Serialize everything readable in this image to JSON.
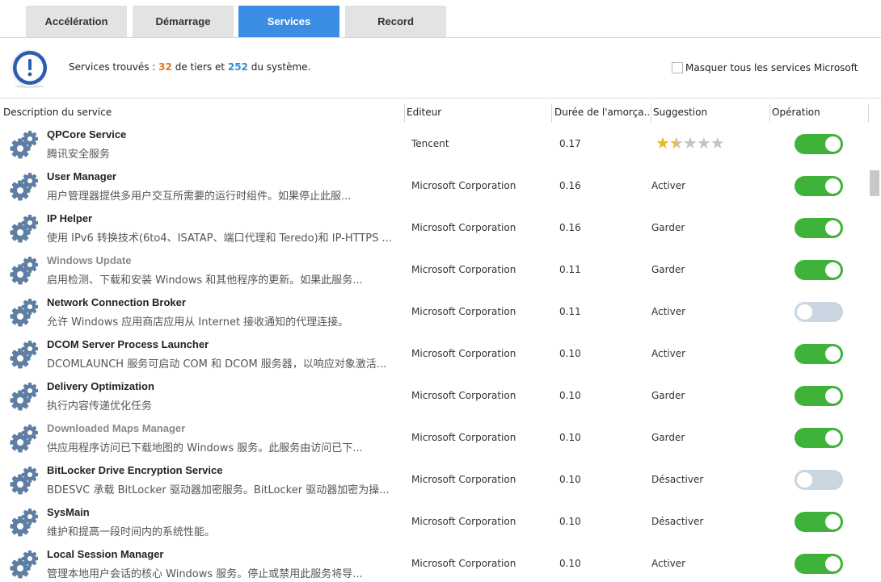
{
  "tabs": [
    {
      "label": "Accélération"
    },
    {
      "label": "Démarrage"
    },
    {
      "label": "Services"
    },
    {
      "label": "Record"
    }
  ],
  "active_tab": "Services",
  "info": {
    "prefix": "Services trouvés :",
    "third_party_count": "32",
    "middle": "de tiers et",
    "system_count": "252",
    "suffix": "du système.",
    "third_party_color": "#e8731c",
    "system_color": "#2b8fd8"
  },
  "hide_microsoft": {
    "label": "Masquer tous les services Microsoft",
    "checked": false
  },
  "columns": {
    "description": "Description du service",
    "publisher": "Editeur",
    "duration": "Durée de l'amorça...",
    "suggestion": "Suggestion",
    "operation": "Opération"
  },
  "services": [
    {
      "name": "QPCore Service",
      "desc": "腾讯安全服务",
      "publisher": "Tencent",
      "duration": "0.17",
      "suggestion": "",
      "rating": 1.5,
      "enabled": true,
      "dim": false
    },
    {
      "name": "User Manager",
      "desc": "用户管理器提供多用户交互所需要的运行时组件。如果停止此服...",
      "publisher": "Microsoft Corporation",
      "duration": "0.16",
      "suggestion": "Activer",
      "enabled": true,
      "dim": false
    },
    {
      "name": "IP Helper",
      "desc": "使用 IPv6 转换技术(6to4、ISATAP、端口代理和 Teredo)和 IP-HTTPS ...",
      "publisher": "Microsoft Corporation",
      "duration": "0.16",
      "suggestion": "Garder",
      "enabled": true,
      "dim": false
    },
    {
      "name": "Windows Update",
      "desc": "启用检测、下载和安装 Windows 和其他程序的更新。如果此服务...",
      "publisher": "Microsoft Corporation",
      "duration": "0.11",
      "suggestion": "Garder",
      "enabled": true,
      "dim": true
    },
    {
      "name": "Network Connection Broker",
      "desc": "允许 Windows 应用商店应用从 Internet 接收通知的代理连接。",
      "publisher": "Microsoft Corporation",
      "duration": "0.11",
      "suggestion": "Activer",
      "enabled": false,
      "dim": false
    },
    {
      "name": "DCOM Server Process Launcher",
      "desc": "DCOMLAUNCH 服务可启动 COM 和 DCOM 服务器，以响应对象激活...",
      "publisher": "Microsoft Corporation",
      "duration": "0.10",
      "suggestion": "Activer",
      "enabled": true,
      "dim": false
    },
    {
      "name": "Delivery Optimization",
      "desc": "执行内容传递优化任务",
      "publisher": "Microsoft Corporation",
      "duration": "0.10",
      "suggestion": "Garder",
      "enabled": true,
      "dim": false
    },
    {
      "name": "Downloaded Maps Manager",
      "desc": "供应用程序访问已下载地图的 Windows 服务。此服务由访问已下...",
      "publisher": "Microsoft Corporation",
      "duration": "0.10",
      "suggestion": "Garder",
      "enabled": true,
      "dim": true
    },
    {
      "name": "BitLocker Drive Encryption Service",
      "desc": "BDESVC 承载 BitLocker 驱动器加密服务。BitLocker 驱动器加密为操...",
      "publisher": "Microsoft Corporation",
      "duration": "0.10",
      "suggestion": "Désactiver",
      "enabled": false,
      "dim": false
    },
    {
      "name": "SysMain",
      "desc": "维护和提高一段时间内的系统性能。",
      "publisher": "Microsoft Corporation",
      "duration": "0.10",
      "suggestion": "Désactiver",
      "enabled": true,
      "dim": false
    },
    {
      "name": "Local Session Manager",
      "desc": "管理本地用户会话的核心 Windows 服务。停止或禁用此服务将导...",
      "publisher": "Microsoft Corporation",
      "duration": "0.10",
      "suggestion": "Activer",
      "enabled": true,
      "dim": false
    }
  ],
  "colors": {
    "accent": "#3b8de3",
    "toggle_on": "#3fb23a",
    "toggle_off": "#c9d5e1",
    "gear": "#5e7ea3"
  }
}
